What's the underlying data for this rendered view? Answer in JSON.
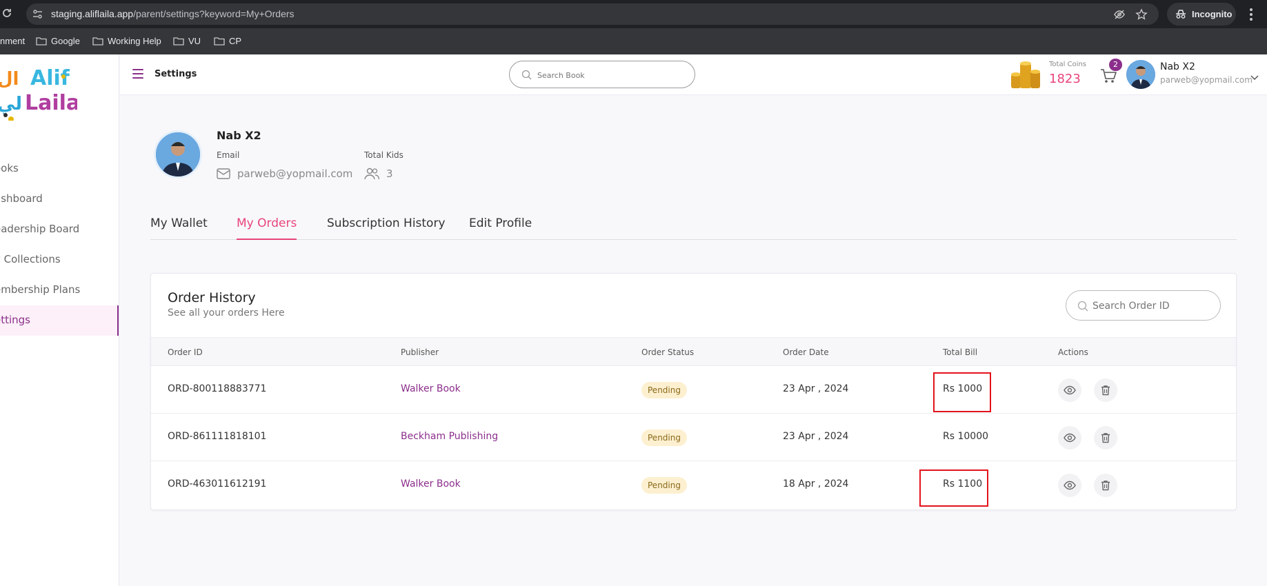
{
  "browser": {
    "url_host": "staging.aliflaila.app",
    "url_path": "/parent/settings?keyword=My+Orders",
    "incognito_label": "Incognito",
    "bookmarks": [
      "nment",
      "Google",
      "Working Help",
      "VU",
      "CP"
    ]
  },
  "sidebar": {
    "logo_text_top": "Alif",
    "logo_text_bottom": "Laila",
    "logo_arabic": "الف ليلى",
    "items": [
      {
        "label": "ooks"
      },
      {
        "label": "ashboard"
      },
      {
        "label": "eadership Board"
      },
      {
        "label": "y Collections"
      },
      {
        "label": "embership Plans"
      },
      {
        "label": "ettings",
        "active": true
      }
    ]
  },
  "header": {
    "title": "Settings",
    "search_placeholder": "Search Book",
    "coins_label": "Total Coins",
    "coins_value": "1823",
    "cart_count": "2",
    "user_name": "Nab X2",
    "user_email": "parweb@yopmail.com"
  },
  "profile": {
    "name": "Nab X2",
    "email_label": "Email",
    "email": "parweb@yopmail.com",
    "kids_label": "Total Kids",
    "kids_count": "3"
  },
  "tabs": [
    {
      "label": "My Wallet",
      "active": false
    },
    {
      "label": "My Orders",
      "active": true
    },
    {
      "label": "Subscription History",
      "active": false
    },
    {
      "label": "Edit Profile",
      "active": false
    }
  ],
  "orders": {
    "title": "Order History",
    "subtitle": "See all your orders Here",
    "search_placeholder": "Search Order ID",
    "columns": [
      "Order ID",
      "Publisher",
      "Order Status",
      "Order Date",
      "Total Bill",
      "Actions"
    ],
    "rows": [
      {
        "order_id": "ORD-800118883771",
        "publisher": "Walker Book",
        "status": "Pending",
        "date": "23 Apr , 2024",
        "total": "Rs 1000"
      },
      {
        "order_id": "ORD-861111818101",
        "publisher": "Beckham Publishing",
        "status": "Pending",
        "date": "23 Apr , 2024",
        "total": "Rs 10000"
      },
      {
        "order_id": "ORD-463011612191",
        "publisher": "Walker Book",
        "status": "Pending",
        "date": "18 Apr , 2024",
        "total": "Rs 1100"
      }
    ]
  },
  "colors": {
    "brand_purple": "#8b2e8b",
    "accent_pink": "#e8447a",
    "highlight_red": "#e3121b",
    "pending_bg": "#fdf0d0"
  }
}
